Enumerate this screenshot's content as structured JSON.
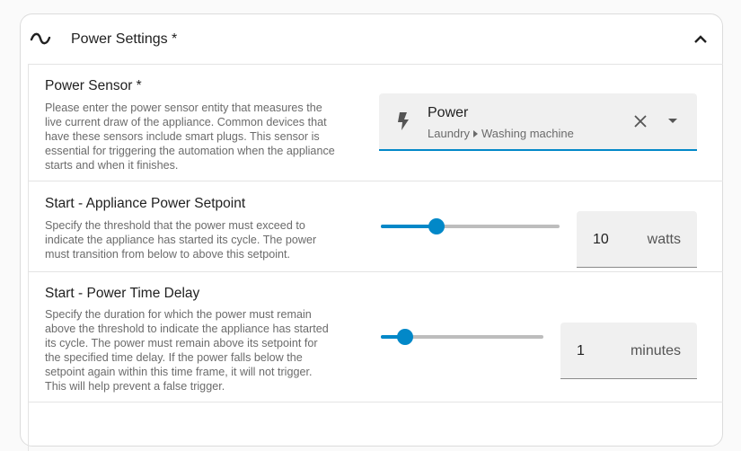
{
  "section": {
    "title": "Power Settings *",
    "icon": "sine-wave-icon",
    "chevron_icon": "chevron-up-icon"
  },
  "power_sensor": {
    "title": "Power Sensor *",
    "description": [
      "Please enter the power sensor entity that measures the",
      "live current draw of the appliance. Common devices that",
      "have these sensors include smart plugs. This sensor is",
      "essential for triggering the automation when the appliance",
      "starts and when it finishes."
    ],
    "entity": {
      "icon": "flash-icon",
      "name": "Power",
      "area": "Laundry",
      "device": "Washing machine",
      "accent": "#0288c8"
    }
  },
  "start_setpoint": {
    "title": "Start - Appliance Power Setpoint",
    "description": [
      "Specify the threshold that the power must exceed to",
      "indicate the appliance has started its cycle. The power",
      "must transition from below to above this setpoint."
    ],
    "value": "10",
    "unit": "watts",
    "slider_fraction": 0.31
  },
  "start_delay": {
    "title": "Start - Power Time Delay",
    "description": [
      "Specify the duration for which the power must remain",
      "above the threshold to indicate the appliance has started",
      "its cycle. The power must remain above its setpoint for",
      "the specified time delay. If the power falls below the",
      "setpoint again within this time frame, it will not trigger.",
      "This will help prevent a false trigger."
    ],
    "value": "1",
    "unit": "minutes",
    "slider_fraction": 0.15
  },
  "colors": {
    "accent": "#0288c8",
    "track": "#bdbdbd",
    "field_bg": "#f0f0f0"
  }
}
